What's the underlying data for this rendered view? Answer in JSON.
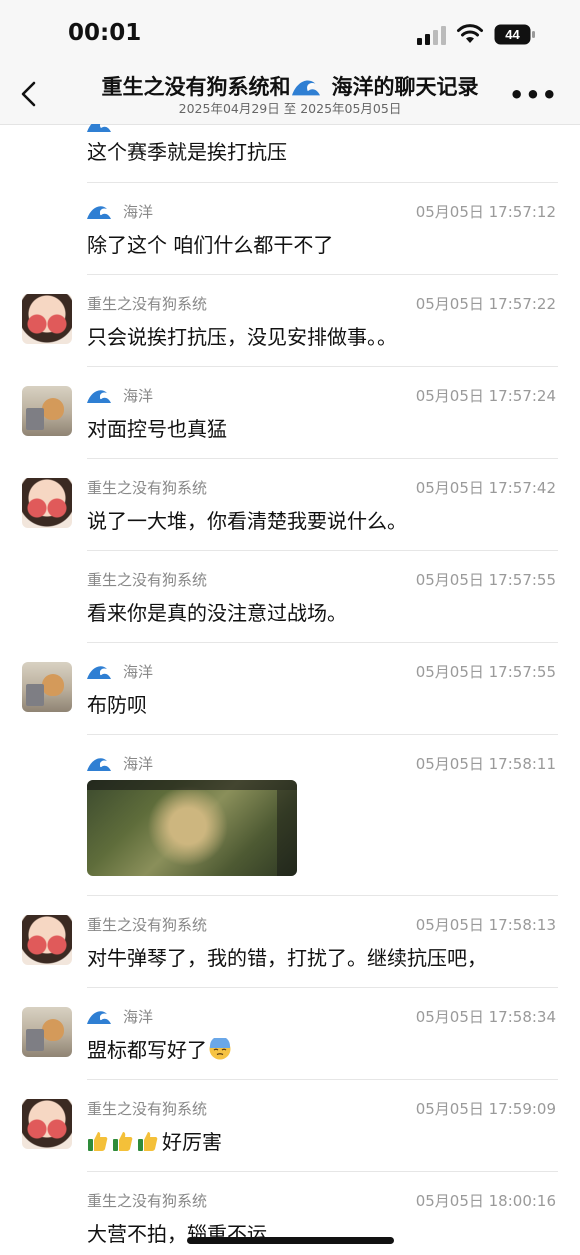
{
  "status_bar": {
    "time": "00:01",
    "battery": "44"
  },
  "header": {
    "title_part1": "重生之没有狗系统和",
    "title_part2": "海洋的聊天记录",
    "subtitle": "2025年04月29日 至 2025年05月05日"
  },
  "partial_top": {
    "text": "这个赛季就是挨打抗压"
  },
  "messages": [
    {
      "sender": "海洋",
      "time": "05月05日 17:57:12",
      "text": "除了这个 咱们什么都干不了"
    },
    {
      "sender": "重生之没有狗系统",
      "time": "05月05日 17:57:22",
      "text": "只会说挨打抗压，没见安排做事。。"
    },
    {
      "sender": "海洋",
      "time": "05月05日 17:57:24",
      "text": "对面控号也真猛"
    },
    {
      "sender": "重生之没有狗系统",
      "time": "05月05日 17:57:42",
      "text": "说了一大堆，你看清楚我要说什么。"
    },
    {
      "sender": "重生之没有狗系统",
      "time": "05月05日 17:57:55",
      "text": "看来你是真的没注意过战场。"
    },
    {
      "sender": "海洋",
      "time": "05月05日 17:57:55",
      "text": "布防呗"
    },
    {
      "sender": "海洋",
      "time": "05月05日 17:58:11"
    },
    {
      "sender": "重生之没有狗系统",
      "time": "05月05日 17:58:13",
      "text": "对牛弹琴了，我的错，打扰了。继续抗压吧，"
    },
    {
      "sender": "海洋",
      "time": "05月05日 17:58:34",
      "text": "盟标都写好了"
    },
    {
      "sender": "重生之没有狗系统",
      "time": "05月05日 17:59:09",
      "text": "好厉害"
    },
    {
      "sender": "重生之没有狗系统",
      "time": "05月05日 18:00:16",
      "text": "大营不拍，辎重不运"
    }
  ]
}
